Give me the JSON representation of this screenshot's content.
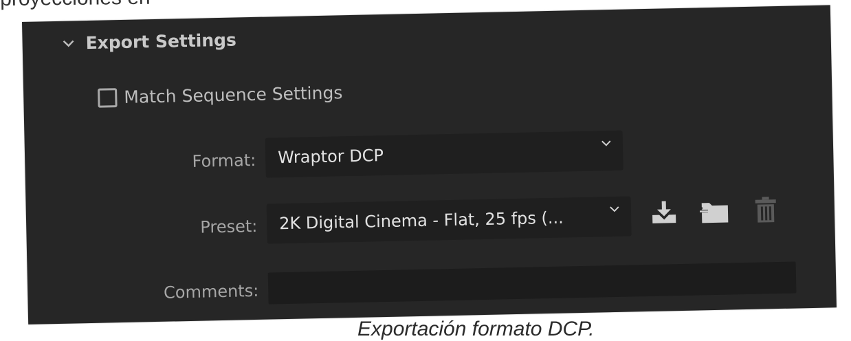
{
  "captions": {
    "top": "proyecciones en",
    "bottom": "Exportación formato DCP."
  },
  "export_settings": {
    "title": "Export Settings",
    "match_sequence_label": "Match Sequence Settings",
    "match_sequence_checked": false,
    "format_label": "Format:",
    "format_value": "Wraptor DCP",
    "preset_label": "Preset:",
    "preset_value": "2K Digital Cinema - Flat, 25 fps (...",
    "comments_label": "Comments:",
    "comments_value": ""
  },
  "icons": {
    "section_toggle": "chevron-down-icon",
    "save_preset": "save-preset-icon",
    "import_preset": "import-preset-icon",
    "delete_preset": "trash-icon"
  },
  "colors": {
    "panel_bg": "#262626",
    "field_bg": "#1f1f1f",
    "label_text": "#a6a6a6",
    "value_text": "#e2e2e2",
    "icon": "#d0d0d0",
    "icon_disabled": "#5a5a5a"
  }
}
